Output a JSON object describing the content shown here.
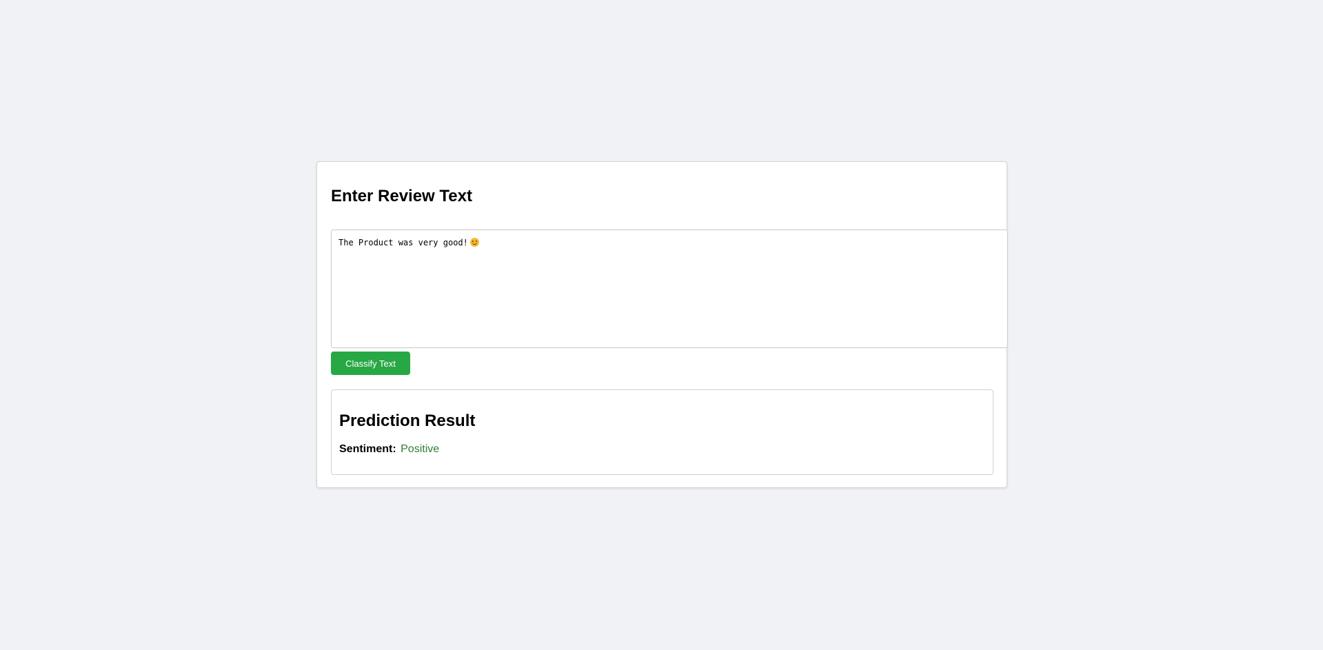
{
  "form": {
    "title": "Enter Review Text",
    "review_text": "The Product was very good!",
    "emoji_icon": "smiling-face-emoji",
    "classify_button_label": "Classify Text"
  },
  "result": {
    "title": "Prediction Result",
    "sentiment_label": "Sentiment:",
    "sentiment_value": "Positive"
  },
  "colors": {
    "background": "#f0f2f5",
    "button": "#28a745",
    "positive": "#2e7d32"
  }
}
